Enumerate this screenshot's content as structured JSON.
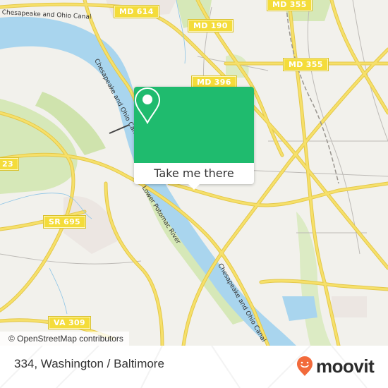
{
  "map": {
    "route_shields": [
      {
        "id": "md-614",
        "label": "MD 614"
      },
      {
        "id": "md-355-top",
        "label": "MD 355"
      },
      {
        "id": "md-190",
        "label": "MD 190"
      },
      {
        "id": "md-355",
        "label": "MD 355"
      },
      {
        "id": "md-396",
        "label": "MD 396"
      },
      {
        "id": "sr-123",
        "label": "23"
      },
      {
        "id": "sr-695",
        "label": "SR 695"
      },
      {
        "id": "va-309",
        "label": "VA 309"
      }
    ],
    "road_labels": [
      {
        "id": "canal-top",
        "label": "Chesapeake and Ohio Canal"
      },
      {
        "id": "canal-mid",
        "label": "Chesapeake and Ohio Canal"
      },
      {
        "id": "river",
        "label": "Lower Potomac River"
      },
      {
        "id": "canal-lower",
        "label": "Chesapeake and Ohio Canal"
      }
    ],
    "colors": {
      "land": "#f2f1ec",
      "water": "#a9d5ee",
      "park": "#d6e8b8",
      "road": "#f6e06a",
      "road_edge": "#e4c84a",
      "shield": "#f4dc3a"
    }
  },
  "popup": {
    "button_label": "Take me there",
    "pin_icon": "map-pin-icon",
    "color": "#1fbb6e"
  },
  "attribution": "© OpenStreetMap contributors",
  "footer": {
    "location_title": "334, Washington / Baltimore",
    "brand": "moovit",
    "brand_color": "#f26a3b"
  }
}
